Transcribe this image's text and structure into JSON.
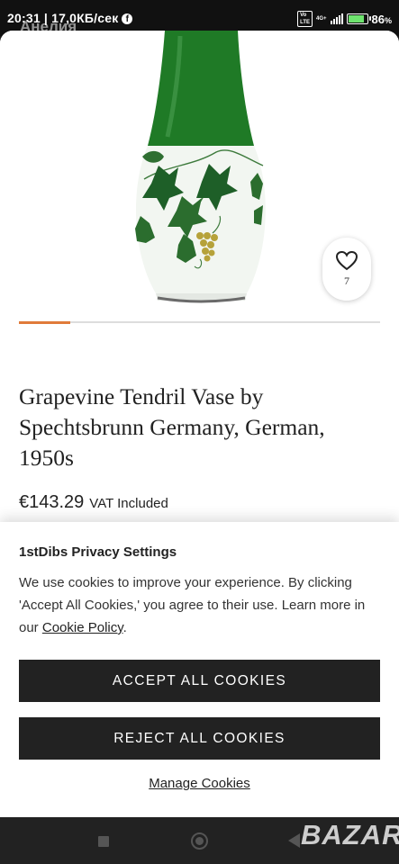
{
  "status": {
    "time": "20:31 | 17,0КБ/сек",
    "ghost_text": "Анелия",
    "battery": "86",
    "battery_unit": "%",
    "network": "4G+"
  },
  "product": {
    "title": "Grapevine Tendril Vase by Spechtsbrunn Germany, German, 1950s",
    "price": "€143.29",
    "vat": "VAT Included",
    "favorite_count": "7",
    "colors": {
      "accent": "#e07b3a",
      "vase_green": "#1f7a26"
    }
  },
  "privacy": {
    "title": "1stDibs Privacy Settings",
    "text_before": "We use cookies to improve your experience. By clicking 'Accept All Cookies,' you agree to their use. Learn more in our ",
    "link": "Cookie Policy",
    "text_after": ".",
    "accept_label": "Accept All Cookies",
    "reject_label": "Reject All Cookies",
    "manage_label": "Manage Cookies"
  },
  "watermark": "BAZAR"
}
